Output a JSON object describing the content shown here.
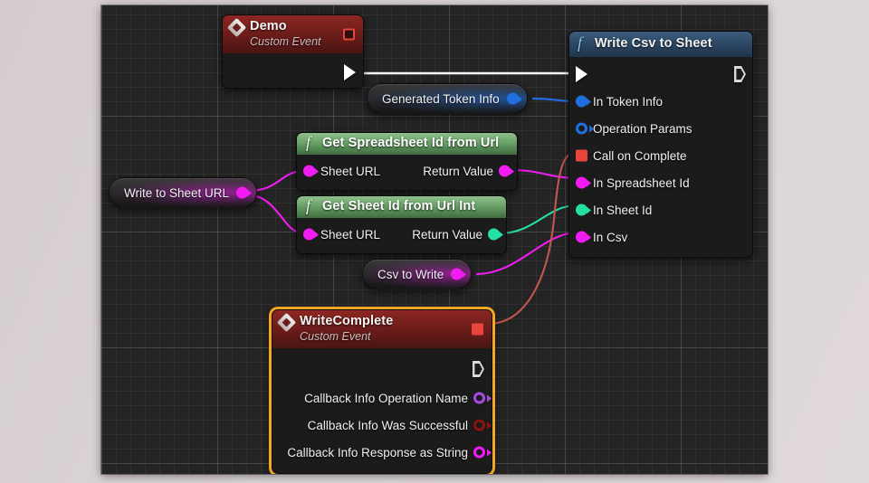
{
  "app": {
    "canvas_name": "blueprint-graph"
  },
  "colors": {
    "exec_white": "#ffffff",
    "event_red": "#e8453c",
    "delegate_red": "#e8453c",
    "string_magenta": "#f11cf1",
    "struct_blue": "#1f6fe0",
    "int_teal": "#26dfa5",
    "name_purple": "#a64be0",
    "bool_darkred": "#8c1111",
    "selection_orange": "#f5a623",
    "canvas_bg": "#242424",
    "page_bg": "#d7d0d1"
  },
  "nodes": {
    "demo_event": {
      "title": "Demo",
      "subtitle": "Custom Event",
      "icon": "event-diamond-icon",
      "delegate_pin": "delegate-output-pin",
      "exec_out": "exec-output-pin"
    },
    "write_csv": {
      "title": "Write Csv to Sheet",
      "icon": "function-f-icon",
      "pins": [
        {
          "label": "In Token Info",
          "type": "struct",
          "color": "#1f6fe0",
          "style": "solid",
          "side": "in"
        },
        {
          "label": "Operation Params",
          "type": "struct",
          "color": "#1f6fe0",
          "style": "hollow",
          "side": "in"
        },
        {
          "label": "Call on Complete",
          "type": "delegate",
          "color": "#e8453c",
          "style": "square",
          "side": "in"
        },
        {
          "label": "In Spreadsheet Id",
          "type": "string",
          "color": "#f11cf1",
          "style": "solid",
          "side": "in"
        },
        {
          "label": "In Sheet Id",
          "type": "int",
          "color": "#26dfa5",
          "style": "solid",
          "side": "in"
        },
        {
          "label": "In Csv",
          "type": "string",
          "color": "#f11cf1",
          "style": "solid",
          "side": "in"
        }
      ]
    },
    "get_spreadsheet_id": {
      "title": "Get Spreadsheet Id from Url",
      "icon": "function-f-icon",
      "input_label": "Sheet URL",
      "input_color": "#f11cf1",
      "output_label": "Return Value",
      "output_color": "#f11cf1"
    },
    "get_sheet_id": {
      "title": "Get Sheet Id from Url Int",
      "icon": "function-f-icon",
      "input_label": "Sheet URL",
      "input_color": "#f11cf1",
      "output_label": "Return Value",
      "output_color": "#26dfa5"
    },
    "write_complete_event": {
      "title": "WriteComplete",
      "subtitle": "Custom Event",
      "icon": "event-diamond-icon",
      "selected": true,
      "pins": [
        {
          "label": "Callback Info Operation Name",
          "color": "#a64be0"
        },
        {
          "label": "Callback Info Was Successful",
          "color": "#8c1111"
        },
        {
          "label": "Callback Info Response as String",
          "color": "#f11cf1"
        }
      ]
    }
  },
  "variables": [
    {
      "label": "Write to Sheet URL",
      "color": "#f11cf1",
      "glow": "rgba(228,28,228,0.50)"
    },
    {
      "label": "Generated Token Info",
      "color": "#1f6fe0",
      "glow": "rgba(32,110,230,0.52)"
    },
    {
      "label": "Csv to Write",
      "color": "#f11cf1",
      "glow": "rgba(228,28,228,0.50)"
    }
  ]
}
